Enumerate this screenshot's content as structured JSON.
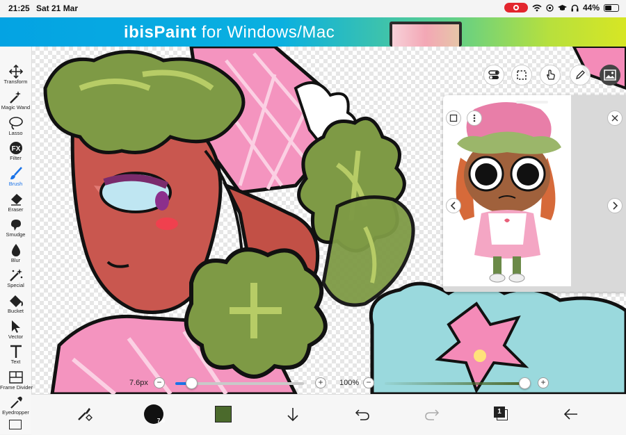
{
  "status_bar": {
    "time": "21:25",
    "date": "Sat 21 Mar",
    "battery": "44%",
    "battery_level": 0.44
  },
  "banner": {
    "brand": "ibisPaint",
    "tagline": "for Windows/Mac"
  },
  "tools": [
    {
      "label": "Transform",
      "icon": "move-arrows-icon"
    },
    {
      "label": "Magic Wand",
      "icon": "magic-wand-icon"
    },
    {
      "label": "Lasso",
      "icon": "lasso-icon"
    },
    {
      "label": "Filter",
      "icon": "fx-filter-icon"
    },
    {
      "label": "Brush",
      "icon": "brush-icon",
      "active": true
    },
    {
      "label": "Eraser",
      "icon": "eraser-icon"
    },
    {
      "label": "Smudge",
      "icon": "smudge-icon"
    },
    {
      "label": "Blur",
      "icon": "blur-drop-icon"
    },
    {
      "label": "Special",
      "icon": "sparkle-wand-icon"
    },
    {
      "label": "Bucket",
      "icon": "paint-bucket-icon"
    },
    {
      "label": "Vector",
      "icon": "vector-cursor-icon"
    },
    {
      "label": "Text",
      "icon": "text-t-icon"
    },
    {
      "label": "Frame Divider",
      "icon": "frame-divider-icon"
    },
    {
      "label": "Eyedropper",
      "icon": "eyedropper-icon"
    }
  ],
  "brush_settings": {
    "size_label": "7.6px",
    "size_fraction": 0.05,
    "opacity_label": "100%",
    "opacity_fraction": 1.0,
    "minus": "−",
    "plus": "+"
  },
  "bottom_bar": {
    "brush_size_badge": "7.6",
    "current_color": "#4b6a2c",
    "layer_count": "1"
  },
  "colors": {
    "accent": "#1a73e8",
    "primary_color": "#4b6a2c"
  }
}
